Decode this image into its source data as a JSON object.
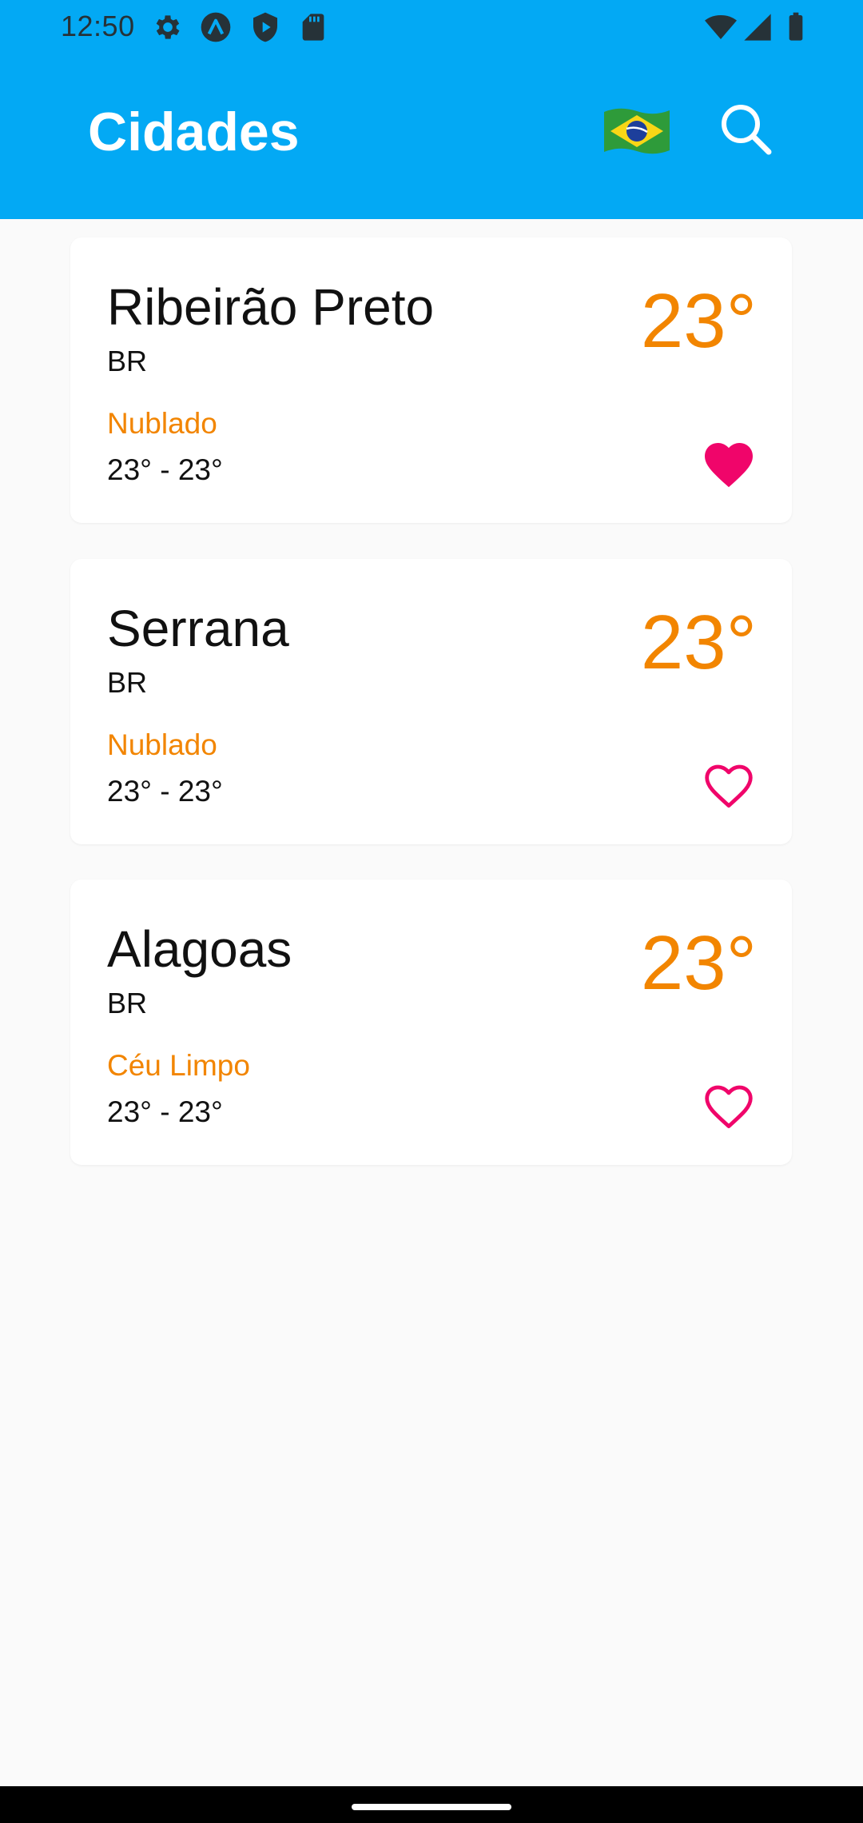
{
  "status_bar": {
    "time": "12:50",
    "icons": [
      "settings-icon",
      "a-icon",
      "shield-play-icon",
      "sd-card-icon",
      "wifi-icon",
      "signal-icon",
      "battery-icon"
    ]
  },
  "app_bar": {
    "title": "Cidades",
    "background": "#03a9f4",
    "actions": [
      "brazil-flag-icon",
      "search-icon"
    ]
  },
  "cities": [
    {
      "name": "Ribeirão Preto",
      "country": "BR",
      "temperature": "23°",
      "condition": "Nublado",
      "range": "23° - 23°",
      "favorite": true
    },
    {
      "name": "Serrana",
      "country": "BR",
      "temperature": "23°",
      "condition": "Nublado",
      "range": "23° - 23°",
      "favorite": false
    },
    {
      "name": "Alagoas",
      "country": "BR",
      "temperature": "23°",
      "condition": "Céu Limpo",
      "range": "23° - 23°",
      "favorite": false
    }
  ],
  "colors": {
    "accent_orange": "#f28500",
    "favorite_pink": "#f0056a",
    "text": "#111111"
  }
}
